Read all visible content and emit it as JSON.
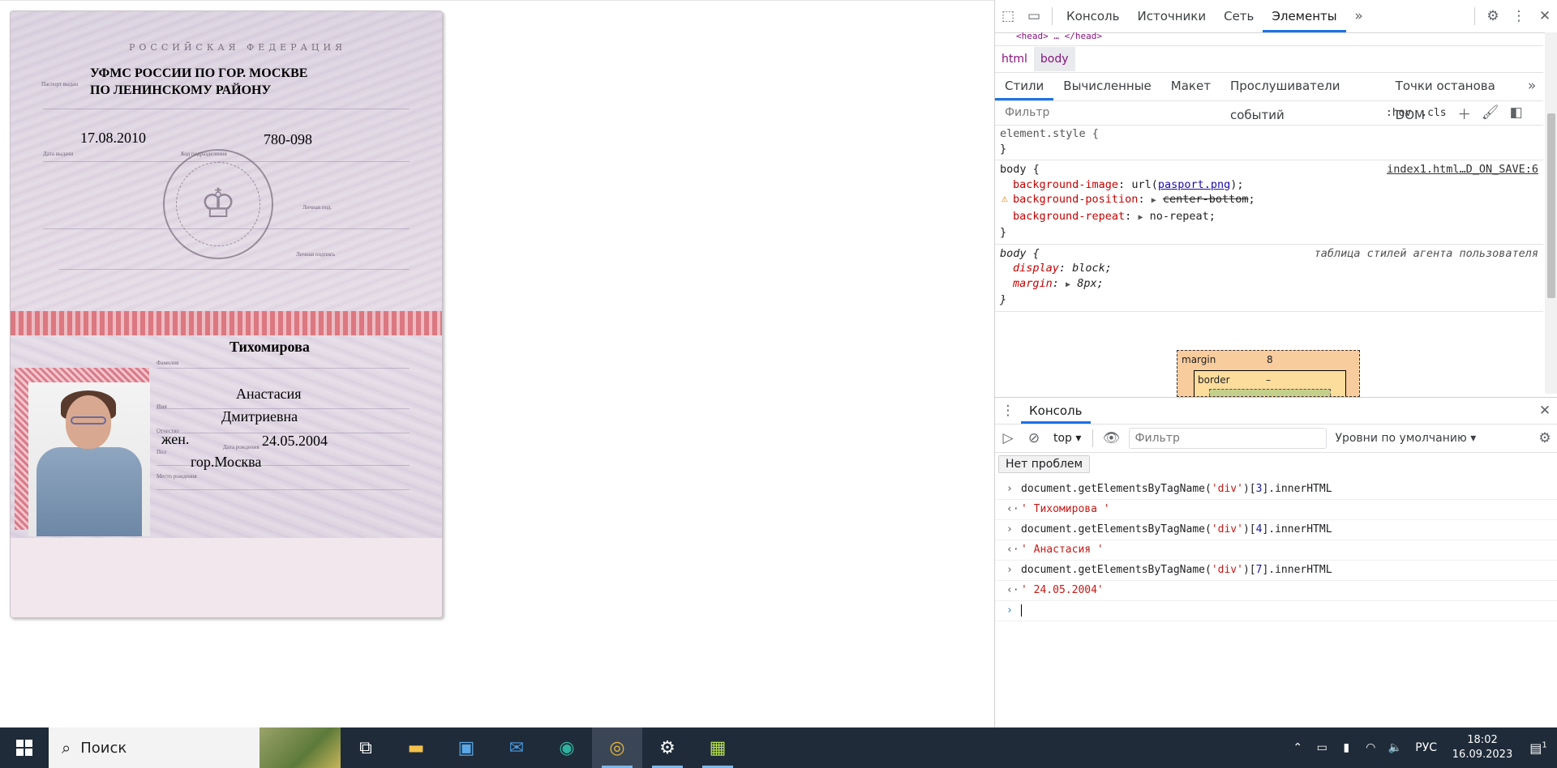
{
  "passport": {
    "country": "РОССИЙСКАЯ ФЕДЕРАЦИЯ",
    "authority_line1": "УФМС РОССИИ ПО ГОР. МОСКВЕ",
    "authority_line2": "ПО ЛЕНИНСКОМУ РАЙОНУ",
    "issue_date": "17.08.2010",
    "division_code": "780-098",
    "surname": "Тихомирова",
    "name": "Анастасия",
    "patronymic": "Дмитриевна",
    "sex": "жен.",
    "birth_date": "24.05.2004",
    "birth_place": "гор.Москва",
    "labels": {
      "issued_by": "Паспорт выдан",
      "issue_date": "Дата выдачи",
      "division_code": "Код подразделения",
      "personal_signature": "Личная под.",
      "official_signature": "Личная подпись",
      "surname": "Фамилия",
      "name": "Имя",
      "patronymic": "Отчество",
      "sex": "Пол",
      "birth_date": "Дата рождения",
      "birth_place": "Место рождения"
    }
  },
  "devtools": {
    "tabs": [
      "Консоль",
      "Источники",
      "Сеть",
      "Элементы"
    ],
    "active_tab": "Элементы",
    "dom_snippet": "<head> … </head>",
    "breadcrumbs": [
      "html",
      "body"
    ],
    "subtabs": [
      "Стили",
      "Вычисленные",
      "Макет",
      "Прослушиватели событий",
      "Точки останова DOM"
    ],
    "filter_placeholder": "Фильтр",
    "hov": ":hov",
    "cls": ".cls",
    "element_style": "element.style {",
    "close_brace": "}",
    "rule1": {
      "selector": "body {",
      "source": "index1.html…D_ON_SAVE:6",
      "p1_name": "background-image",
      "p1_pre": "url(",
      "p1_link": "pasport.png",
      "p1_post": ");",
      "p2_name": "background-position",
      "p2_value": "center-bottom",
      "p3_name": "background-repeat",
      "p3_value": "no-repeat;"
    },
    "rule2": {
      "selector": "body {",
      "source": "таблица стилей агента пользователя",
      "p1_name": "display",
      "p1_value": "block;",
      "p2_name": "margin",
      "p2_value": "8px;"
    },
    "boxmodel": {
      "margin_label": "margin",
      "margin_value": "8",
      "border_label": "border",
      "border_value": "–"
    },
    "drawer_tab": "Консоль",
    "console_context": "top",
    "console_filter": "Фильтр",
    "levels": "Уровни по умолчанию",
    "issues": "Нет проблем",
    "lines": [
      {
        "cmd_pre": "document.getElementsByTagName(",
        "cmd_arg": "'div'",
        "cmd_idx": "3",
        "cmd_post": "].innerHTML",
        "result": "' Тихомирова '"
      },
      {
        "cmd_pre": "document.getElementsByTagName(",
        "cmd_arg": "'div'",
        "cmd_idx": "4",
        "cmd_post": "].innerHTML",
        "result": "' Анастасия '"
      },
      {
        "cmd_pre": "document.getElementsByTagName(",
        "cmd_arg": "'div'",
        "cmd_idx": "7",
        "cmd_post": "].innerHTML",
        "result": "' 24.05.2004'"
      }
    ]
  },
  "taskbar": {
    "search_placeholder": "Поиск",
    "language": "РУС",
    "time": "18:02",
    "date": "16.09.2023",
    "notifications": "1"
  }
}
